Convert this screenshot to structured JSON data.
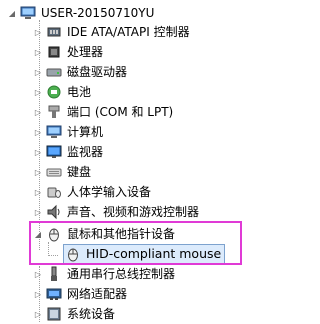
{
  "tree": {
    "root": "USER-20150710YU",
    "items": [
      {
        "label": "IDE ATA/ATAPI 控制器",
        "icon": "ide-controller-icon"
      },
      {
        "label": "处理器",
        "icon": "processor-icon"
      },
      {
        "label": "磁盘驱动器",
        "icon": "disk-drive-icon"
      },
      {
        "label": "电池",
        "icon": "battery-icon"
      },
      {
        "label": "端口 (COM 和 LPT)",
        "icon": "port-icon"
      },
      {
        "label": "计算机",
        "icon": "computer-icon"
      },
      {
        "label": "监视器",
        "icon": "monitor-icon"
      },
      {
        "label": "键盘",
        "icon": "keyboard-icon"
      },
      {
        "label": "人体学输入设备",
        "icon": "hid-icon"
      },
      {
        "label": "声音、视频和游戏控制器",
        "icon": "sound-icon"
      },
      {
        "label": "鼠标和其他指针设备",
        "icon": "mouse-icon"
      },
      {
        "label": "HID-compliant mouse",
        "icon": "mouse-icon"
      },
      {
        "label": "通用串行总线控制器",
        "icon": "usb-controller-icon"
      },
      {
        "label": "网络适配器",
        "icon": "network-adapter-icon"
      },
      {
        "label": "系统设备",
        "icon": "system-device-icon"
      }
    ]
  },
  "colors": {
    "highlight_border": "#e03ad6",
    "selection_bg": "#dcebfc",
    "selection_border": "#7da2ce"
  }
}
